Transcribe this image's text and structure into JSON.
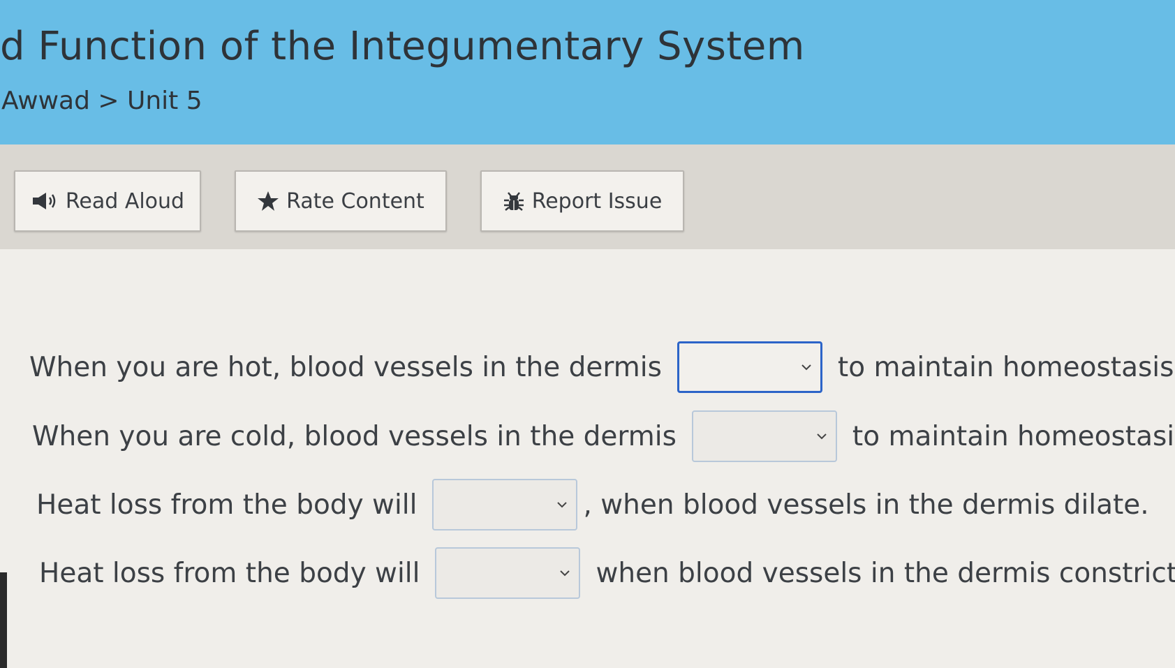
{
  "header": {
    "title": "d Function of the Integumentary System",
    "breadcrumb": "Awwad > Unit 5"
  },
  "toolbar": {
    "read_aloud_label": "Read Aloud",
    "read_aloud_icon": "speaker-icon",
    "rate_content_label": "Rate Content",
    "rate_content_icon": "star-icon",
    "report_issue_label": "Report Issue",
    "report_issue_icon": "bug-icon"
  },
  "questions": [
    {
      "before": "When you are hot, blood vessels in the dermis",
      "after": "to maintain homeostasis.",
      "selected": ""
    },
    {
      "before": "When you are cold, blood vessels in the dermis",
      "after": "to maintain homeostasis.",
      "selected": ""
    },
    {
      "before": "Heat loss from the body will",
      "after": ", when blood vessels in the dermis dilate.",
      "selected": ""
    },
    {
      "before": "Heat loss from the body will",
      "after": "when blood vessels in the dermis constrict.",
      "selected": ""
    }
  ],
  "colors": {
    "header_bg": "#68bde6",
    "toolbar_bg": "#dad7d1",
    "content_bg": "#f0eeea",
    "focus_border": "#2c64c8"
  }
}
